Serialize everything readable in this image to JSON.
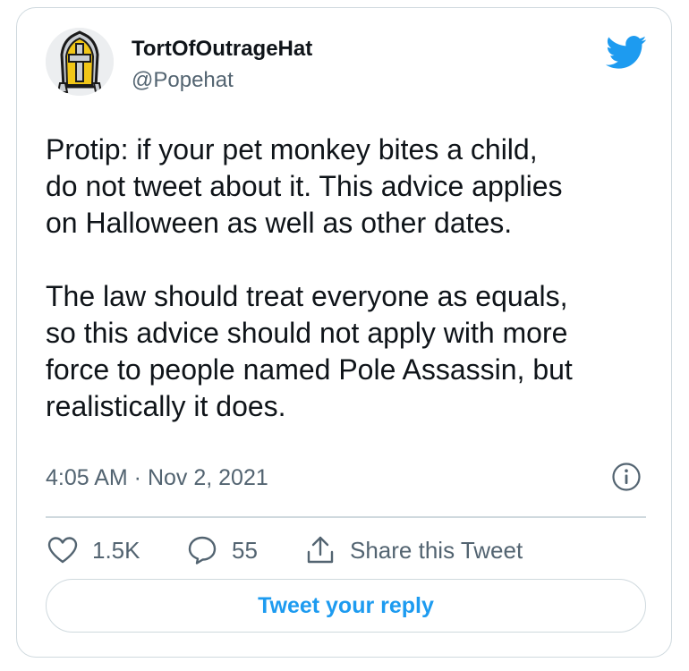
{
  "author": {
    "display_name": "TortOfOutrageHat",
    "handle": "@Popehat",
    "avatar_icon": "pope-hat-icon"
  },
  "brand": {
    "icon": "twitter-bird-icon",
    "color": "#1d9bf0"
  },
  "tweet": {
    "paragraphs": [
      "Protip:  if your pet monkey bites a child,\ndo not tweet about it.  This advice applies\non Halloween as well as other dates.",
      "The law should treat everyone as equals,\nso this advice should not apply with more\nforce to people named Pole Assassin, but\nrealistically it does."
    ],
    "timestamp": "4:05 AM · Nov 2, 2021",
    "info_icon": "info-icon"
  },
  "actions": {
    "like": {
      "icon": "heart-icon",
      "count": "1.5K"
    },
    "reply": {
      "icon": "reply-bubble-icon",
      "count": "55"
    },
    "share": {
      "icon": "share-icon",
      "label": "Share this Tweet"
    }
  },
  "reply_box": {
    "label": "Tweet your reply"
  },
  "colors": {
    "text_primary": "#0f1419",
    "text_secondary": "#536471",
    "border": "#cfd9de",
    "accent": "#1d9bf0"
  }
}
